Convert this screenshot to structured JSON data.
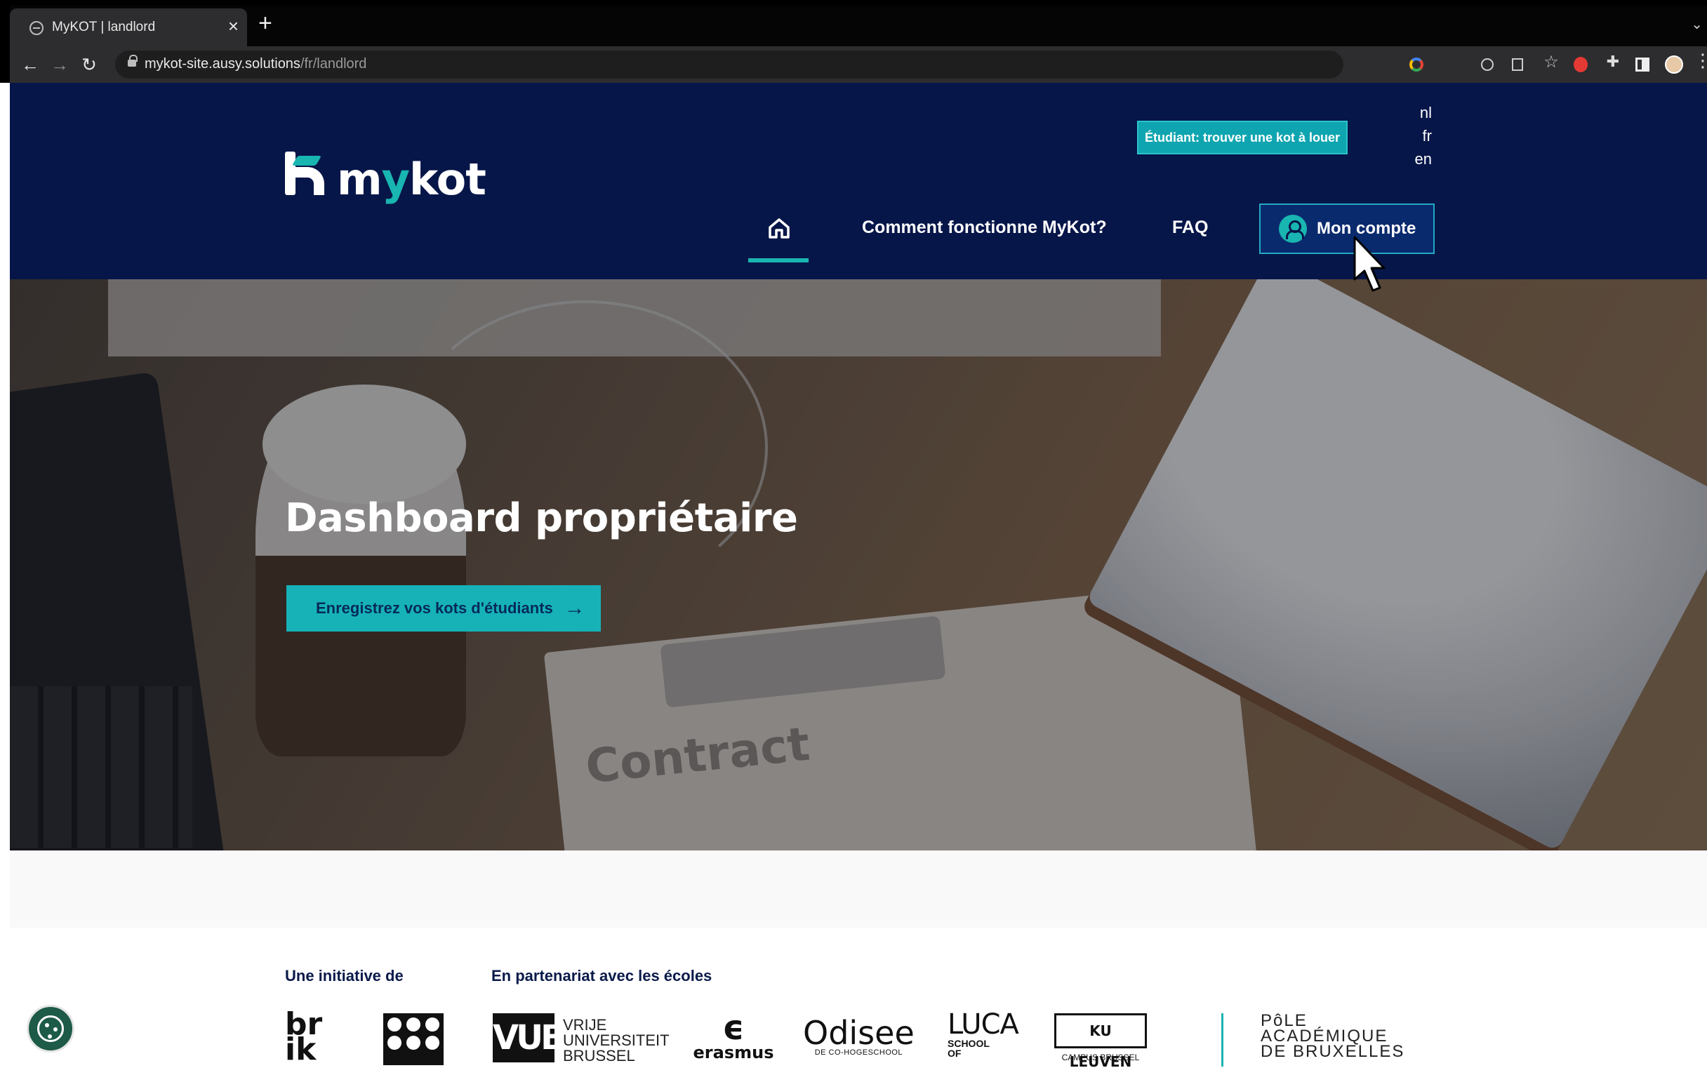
{
  "browser": {
    "tab_title": "MyKOT | landlord",
    "tab_close": "×",
    "new_tab": "+",
    "url_host": "mykot-site.ausy.solutions",
    "url_path": "/fr/landlord",
    "icons": [
      "back-arrow-icon",
      "forward-arrow-icon",
      "reload-icon",
      "lock-icon",
      "google-icon",
      "zoom-icon",
      "share-icon",
      "bookmark-star-icon",
      "extension-icon",
      "puzzle-icon",
      "side-panel-icon",
      "profile-icon",
      "menu-icon"
    ]
  },
  "header": {
    "logo_text_m": "m",
    "logo_text_y": "y",
    "logo_text_rest": "kot",
    "student_button": "Étudiant: trouver une kot à louer",
    "languages": [
      "nl",
      "fr",
      "en"
    ],
    "nav": {
      "how_it_works": "Comment fonctionne MyKot?",
      "faq": "FAQ",
      "account": "Mon compte"
    },
    "colors": {
      "navy": "#071649",
      "teal": "#19b5b0"
    }
  },
  "hero": {
    "title": "Dashboard propriétaire",
    "cta": "Enregistrez vos kots d'étudiants",
    "background_text": "Contract"
  },
  "footer": {
    "initiative_heading": "Une initiative de",
    "partners_heading": "En partenariat avec les écoles",
    "brik": "br\nik",
    "vub_mark": "VUB",
    "vub_text": "VRIJE\nUNIVERSITEIT\nBRUSSEL",
    "erasmus_text": "erasmus",
    "odisee": "Odisee",
    "odisee_sub": "DE CO-HOGESCHOOL",
    "luca": "LUCA",
    "luca_sub": "SCHOOL\nOF",
    "kul": "KU LEUVEN",
    "kul_sub": "CAMPUS BRUSSEL",
    "pole": "PôLE\nACADÉMIQUE\nDE BRUXELLES"
  }
}
